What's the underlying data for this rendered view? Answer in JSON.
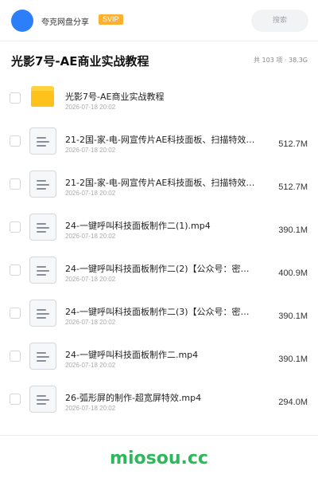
{
  "header": {
    "share_name": "夸克网盘分享",
    "badge": "SVIP",
    "search_placeholder": "搜索"
  },
  "folder": {
    "title": "光影7号-AE商业实战教程",
    "summary": "共 103 项 · 38.3G"
  },
  "files": [
    {
      "name": "光影7号-AE商业实战教程",
      "date": "2026-07-18 20:02",
      "size": "",
      "icon": "folder-icon"
    },
    {
      "name": "21-2国-家-电-网宣传片AE科技面板、扫描特效…",
      "date": "2026-07-18 20:02",
      "size": "512.7M",
      "icon": "video-file-icon"
    },
    {
      "name": "21-2国-家-电-网宣传片AE科技面板、扫描特效…",
      "date": "2026-07-18 20:02",
      "size": "512.7M",
      "icon": "video-file-icon"
    },
    {
      "name": "24-一键呼叫科技面板制作二(1).mp4",
      "date": "2026-07-18 20:02",
      "size": "390.1M",
      "icon": "video-file-icon"
    },
    {
      "name": "24-一键呼叫科技面板制作二(2)【公众号：密知圈…",
      "date": "2026-07-18 20:02",
      "size": "400.9M",
      "icon": "video-file-icon"
    },
    {
      "name": "24-一键呼叫科技面板制作二(3)【公众号：密知圈…",
      "date": "2026-07-18 20:02",
      "size": "390.1M",
      "icon": "video-file-icon"
    },
    {
      "name": "24-一键呼叫科技面板制作二.mp4",
      "date": "2026-07-18 20:02",
      "size": "390.1M",
      "icon": "video-file-icon"
    },
    {
      "name": "26-弧形屏的制作-超宽屏特效.mp4",
      "date": "2026-07-18 20:02",
      "size": "294.0M",
      "icon": "video-file-icon"
    }
  ],
  "watermark": "miosou.cc",
  "colors": {
    "accent": "#2d7ff9",
    "svip": "#ffb02e",
    "folder": "#ffc21a",
    "watermark": "#2eb85c"
  }
}
